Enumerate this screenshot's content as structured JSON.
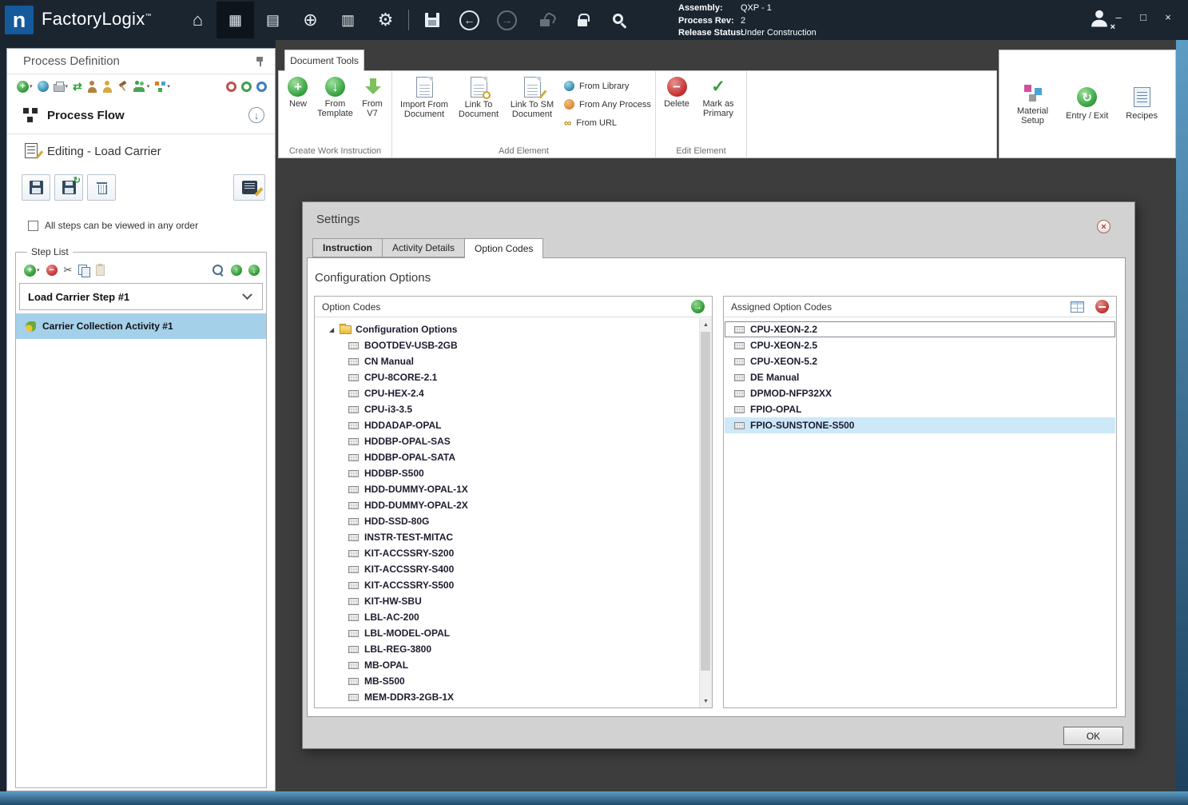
{
  "titlebar": {
    "app_name": "FactoryLogix",
    "tm": "™",
    "assembly_label": "Assembly:",
    "assembly_value": "QXP - 1",
    "process_rev_label": "Process Rev:",
    "process_rev_value": "2",
    "release_status_label": "Release Status:",
    "release_status_value": "Under Construction"
  },
  "sidebar": {
    "title": "Process Definition",
    "process_flow": "Process Flow",
    "editing": "Editing - Load Carrier",
    "order_checkbox": "All steps can be viewed in any order",
    "step_list_title": "Step List",
    "step_header": "Load Carrier Step #1",
    "activity": "Carrier Collection Activity #1"
  },
  "ribbon": {
    "tab": "Document Tools",
    "create_group": {
      "label": "Create Work Instruction",
      "new": "New",
      "from_template": "From\nTemplate",
      "from_v7": "From\nV7"
    },
    "add_group": {
      "label": "Add Element",
      "import_from_document": "Import From\nDocument",
      "link_to_document": "Link To\nDocument",
      "link_to_sm_document": "Link To SM\nDocument",
      "from_library": "From Library",
      "from_any_process": "From Any Process",
      "from_url": "From URL"
    },
    "edit_group": {
      "label": "Edit Element",
      "delete": "Delete",
      "mark_as_primary": "Mark as\nPrimary"
    },
    "right_panel": {
      "material_setup": "Material\nSetup",
      "entry_exit": "Entry / Exit",
      "recipes": "Recipes"
    }
  },
  "dialog": {
    "title": "Settings",
    "tabs": [
      {
        "label": "Instruction",
        "state": "bold"
      },
      {
        "label": "Activity Details",
        "state": ""
      },
      {
        "label": "Option Codes",
        "state": "active"
      }
    ],
    "heading": "Configuration Options",
    "option_codes": {
      "title": "Option Codes",
      "root": "Configuration Options",
      "items": [
        "BOOTDEV-USB-2GB",
        "CN Manual",
        "CPU-8CORE-2.1",
        "CPU-HEX-2.4",
        "CPU-i3-3.5",
        "HDDADAP-OPAL",
        "HDDBP-OPAL-SAS",
        "HDDBP-OPAL-SATA",
        "HDDBP-S500",
        "HDD-DUMMY-OPAL-1X",
        "HDD-DUMMY-OPAL-2X",
        "HDD-SSD-80G",
        "INSTR-TEST-MITAC",
        "KIT-ACCSSRY-S200",
        "KIT-ACCSSRY-S400",
        "KIT-ACCSSRY-S500",
        "KIT-HW-SBU",
        "LBL-AC-200",
        "LBL-MODEL-OPAL",
        "LBL-REG-3800",
        "MB-OPAL",
        "MB-S500",
        "MEM-DDR3-2GB-1X"
      ]
    },
    "assigned": {
      "title": "Assigned Option Codes",
      "items": [
        {
          "label": "CPU-XEON-2.2",
          "state": "focused"
        },
        {
          "label": "CPU-XEON-2.5",
          "state": ""
        },
        {
          "label": "CPU-XEON-5.2",
          "state": ""
        },
        {
          "label": "DE Manual",
          "state": ""
        },
        {
          "label": "DPMOD-NFP32XX",
          "state": ""
        },
        {
          "label": "FPIO-OPAL",
          "state": ""
        },
        {
          "label": "FPIO-SUNSTONE-S500",
          "state": "selected"
        }
      ]
    },
    "ok": "OK"
  }
}
